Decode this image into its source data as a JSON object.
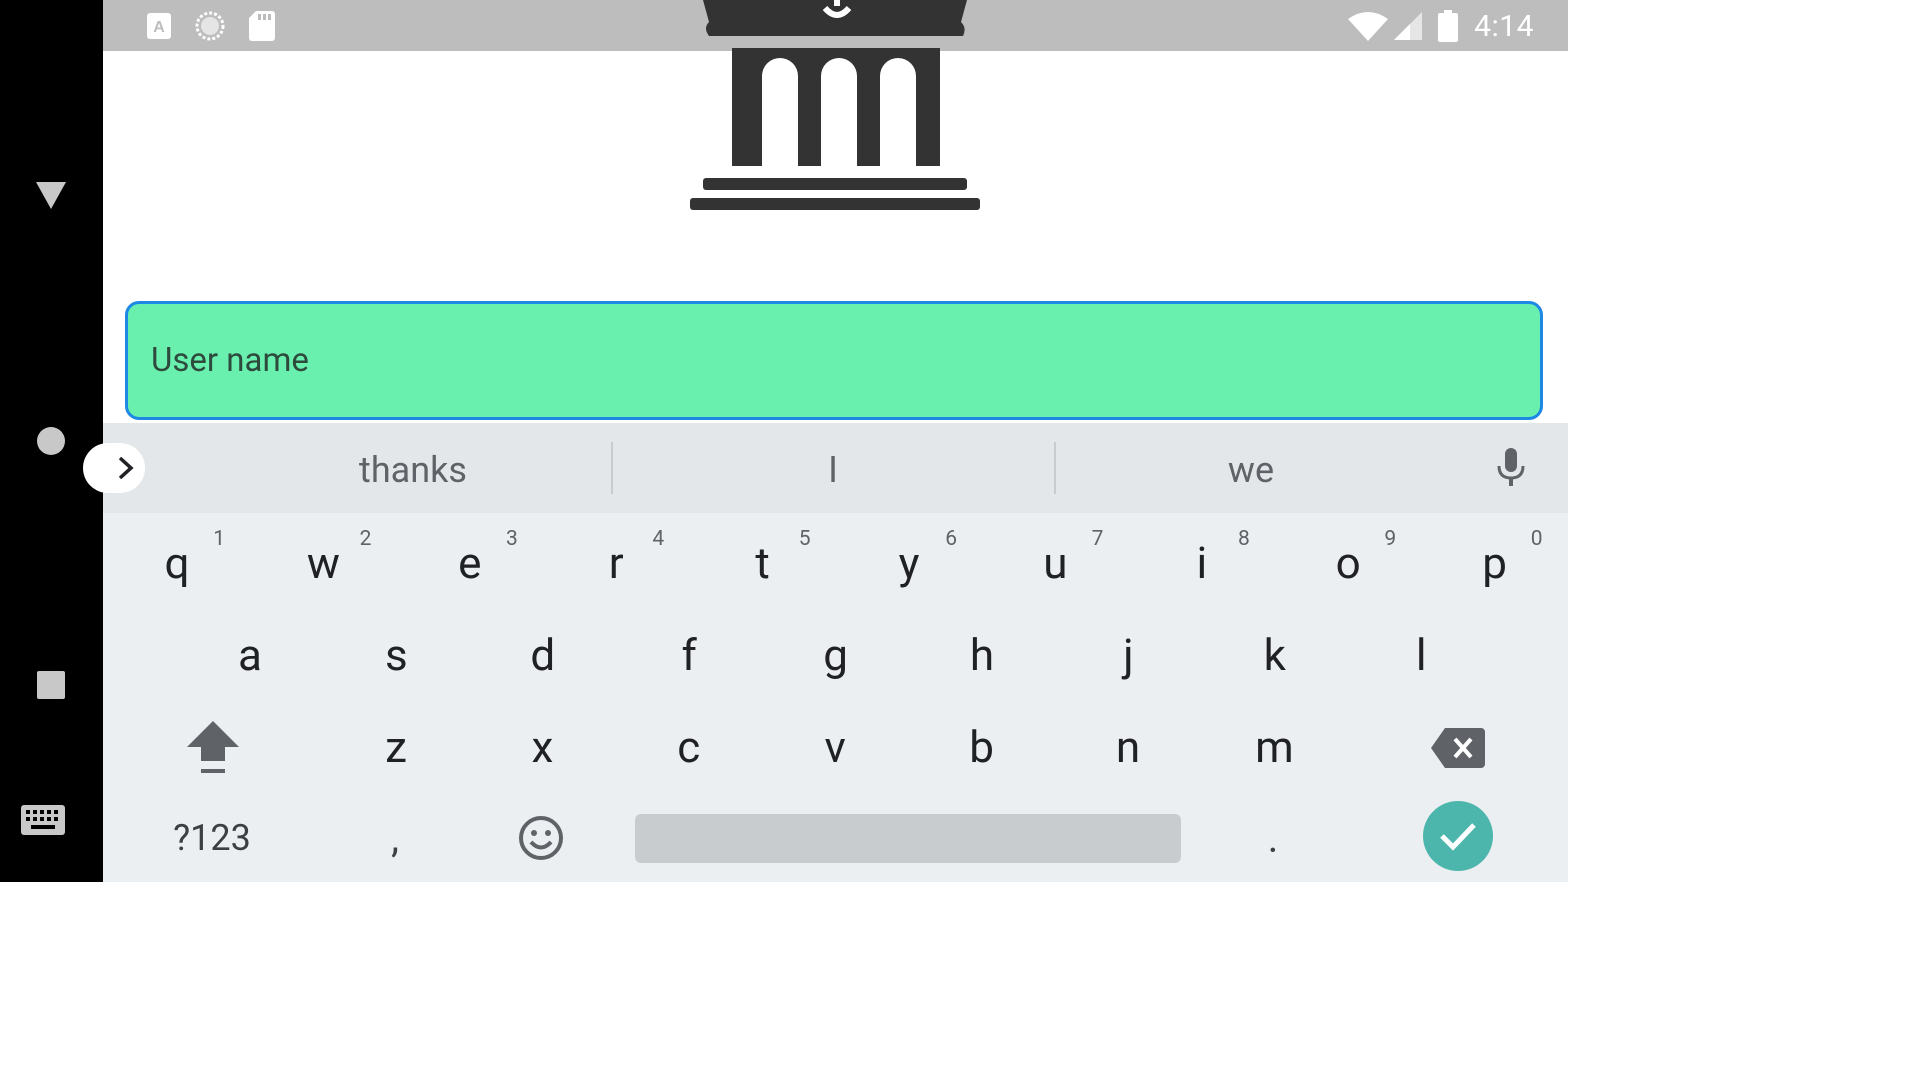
{
  "status_bar": {
    "time": "4:14",
    "icons": [
      "text-notification-icon",
      "sync-icon",
      "sd-card-icon",
      "wifi-icon",
      "cell-signal-icon",
      "battery-icon"
    ]
  },
  "app": {
    "logo_icon": "bank-icon",
    "username_placeholder": "User name"
  },
  "keyboard": {
    "suggestions": [
      "thanks",
      "I",
      "we"
    ],
    "rows": [
      [
        {
          "k": "q",
          "h": "1"
        },
        {
          "k": "w",
          "h": "2"
        },
        {
          "k": "e",
          "h": "3"
        },
        {
          "k": "r",
          "h": "4"
        },
        {
          "k": "t",
          "h": "5"
        },
        {
          "k": "y",
          "h": "6"
        },
        {
          "k": "u",
          "h": "7"
        },
        {
          "k": "i",
          "h": "8"
        },
        {
          "k": "o",
          "h": "9"
        },
        {
          "k": "p",
          "h": "0"
        }
      ],
      [
        "a",
        "s",
        "d",
        "f",
        "g",
        "h",
        "j",
        "k",
        "l"
      ],
      [
        "z",
        "x",
        "c",
        "v",
        "b",
        "n",
        "m"
      ]
    ],
    "symbols_label": "?123",
    "comma": ",",
    "period": "."
  },
  "nav_bar": {
    "icons": [
      "back-icon",
      "home-icon",
      "recents-icon",
      "keyboard-icon"
    ]
  },
  "colors": {
    "field_bg": "#69f0ae",
    "field_border": "#1e88e5",
    "enter_key": "#4db6ac",
    "keyboard_bg": "#eceff1"
  }
}
